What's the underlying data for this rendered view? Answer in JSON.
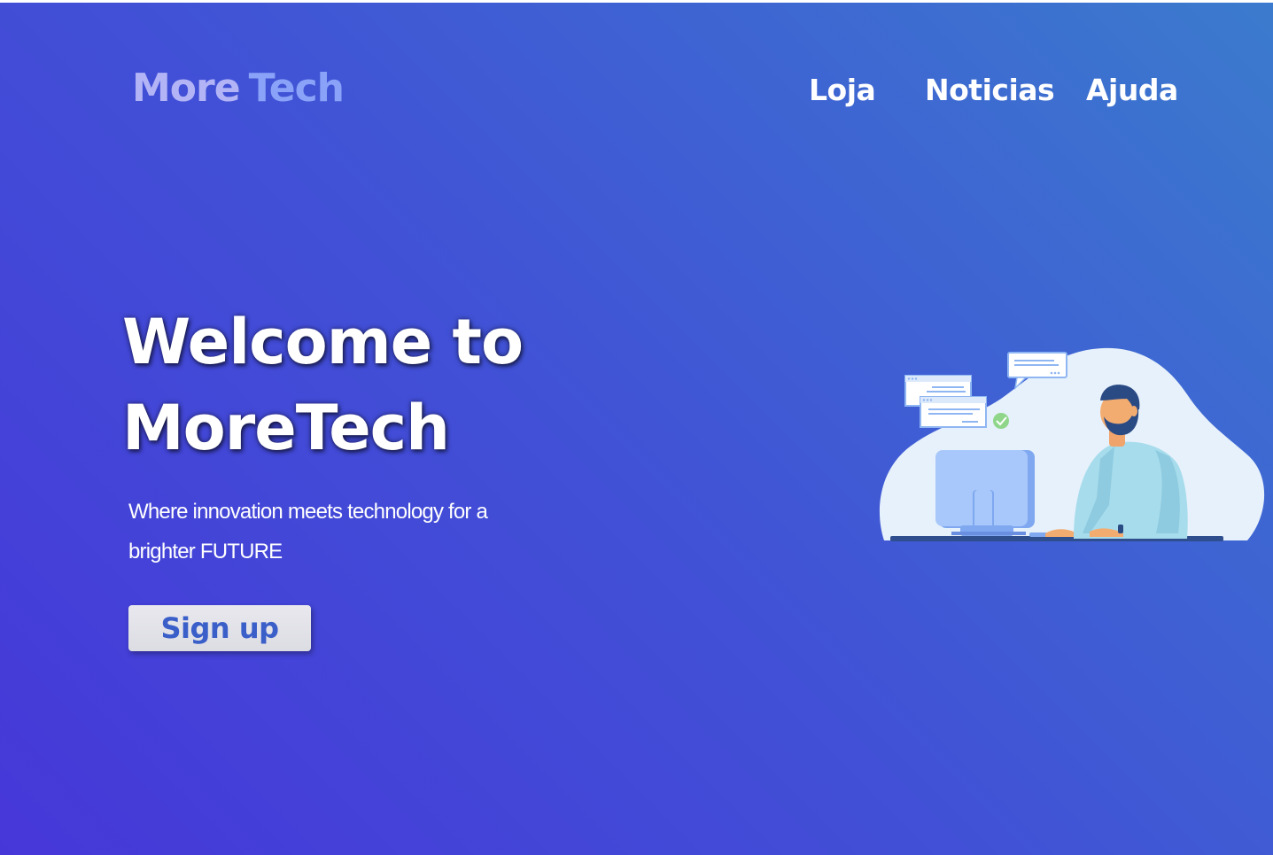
{
  "header": {
    "logo_part1": "More",
    "logo_part2": "Tech",
    "nav": [
      {
        "label": "Loja"
      },
      {
        "label": "Noticias"
      },
      {
        "label": "Ajuda"
      }
    ]
  },
  "hero": {
    "title_line1": "Welcome to",
    "title_line2": "MoreTech",
    "subtitle": "Where innovation meets technology for a brighter FUTURE",
    "signup_label": "Sign up"
  },
  "colors": {
    "background_start": "#4637d9",
    "background_end": "#3b7bcd",
    "logo_more": "#b3b4f6",
    "logo_tech": "#8aa2f7",
    "button_bg": "#e2e2e8",
    "button_text": "#3b5fc9"
  },
  "illustration": {
    "icon": "person-at-computer-illustration"
  }
}
